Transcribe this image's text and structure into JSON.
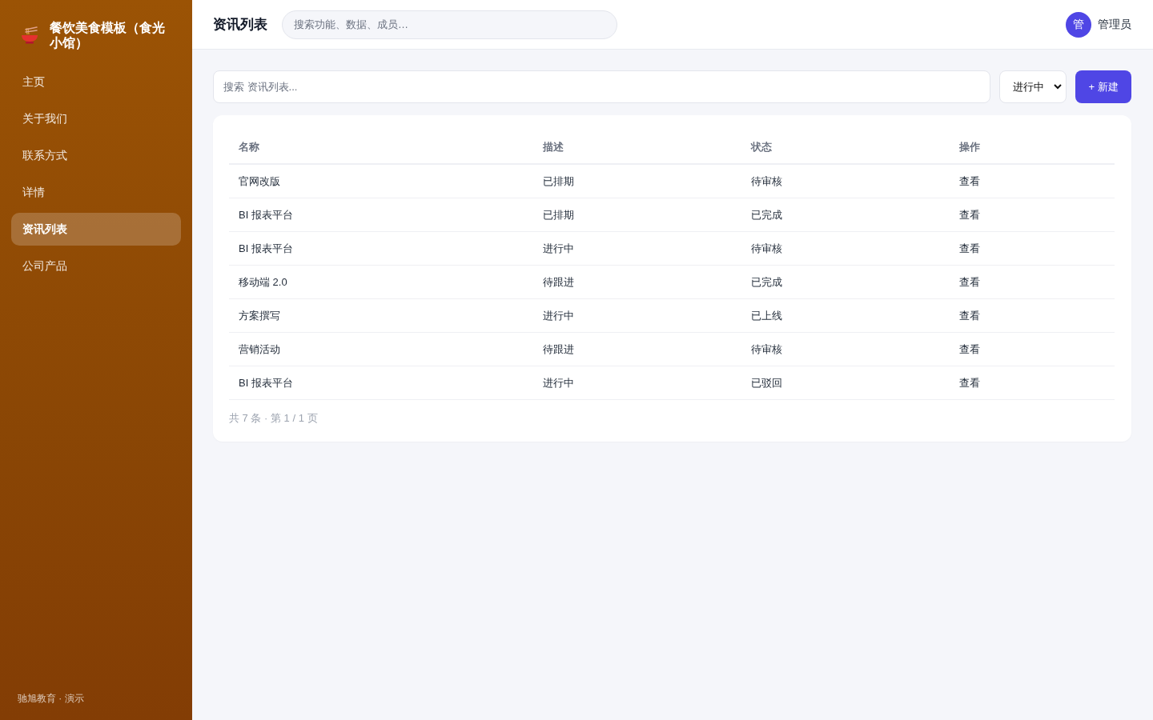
{
  "sidebar": {
    "brand": {
      "title": "餐饮美食模板（食光小馆）"
    },
    "items": [
      {
        "label": "主页",
        "selected": false
      },
      {
        "label": "关于我们",
        "selected": false
      },
      {
        "label": "联系方式",
        "selected": false
      },
      {
        "label": "详情",
        "selected": false
      },
      {
        "label": "资讯列表",
        "selected": true
      },
      {
        "label": "公司产品",
        "selected": false
      }
    ],
    "footer": "驰旭教育 · 演示"
  },
  "header": {
    "title": "资讯列表",
    "search": {
      "placeholder": "搜索功能、数据、成员…"
    },
    "user": {
      "avatar": "管",
      "name": "管理员"
    }
  },
  "toolbar": {
    "search": {
      "placeholder": "搜索 资讯列表..."
    },
    "filter": {
      "value": "进行中"
    },
    "new_button": "+ 新建"
  },
  "table": {
    "columns": [
      "名称",
      "描述",
      "状态",
      "操作"
    ],
    "rows": [
      {
        "name": "官网改版",
        "description": "已排期",
        "status": "待审核",
        "action": "查看"
      },
      {
        "name": "BI 报表平台",
        "description": "已排期",
        "status": "已完成",
        "action": "查看"
      },
      {
        "name": "BI 报表平台",
        "description": "进行中",
        "status": "待审核",
        "action": "查看"
      },
      {
        "name": "移动端 2.0",
        "description": "待跟进",
        "status": "已完成",
        "action": "查看"
      },
      {
        "name": "方案撰写",
        "description": "进行中",
        "status": "已上线",
        "action": "查看"
      },
      {
        "name": "营销活动",
        "description": "待跟进",
        "status": "待审核",
        "action": "查看"
      },
      {
        "name": "BI 报表平台",
        "description": "进行中",
        "status": "已驳回",
        "action": "查看"
      }
    ],
    "pagination": "共 7 条 · 第 1 / 1 页"
  }
}
